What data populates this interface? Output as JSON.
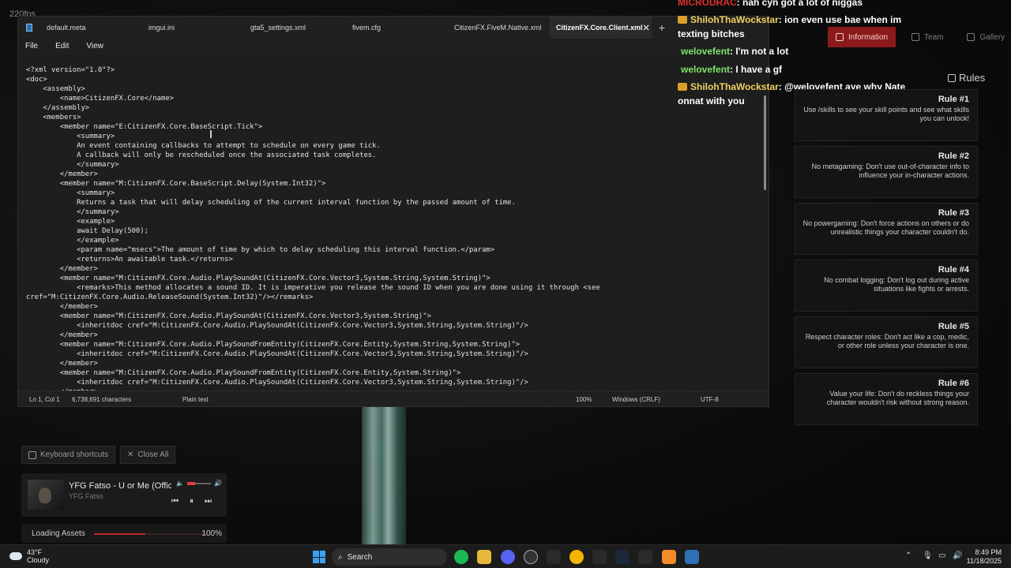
{
  "overlay": {
    "fps_text": "220fps"
  },
  "notepad": {
    "tabs": [
      {
        "label": "default.meta"
      },
      {
        "label": "imgui.ini"
      },
      {
        "label": "gta5_settings.xml"
      },
      {
        "label": "fivem.cfg"
      },
      {
        "label": "CitizenFX.FiveM.Native.xml"
      },
      {
        "label": "CitizenFX.Core.Client.xml",
        "active": true
      }
    ],
    "close_glyph": "✕",
    "newtab_glyph": "+",
    "menu": {
      "file": "File",
      "edit": "Edit",
      "view": "View"
    },
    "lines": [
      "<?xml version=\"1.0\"?>",
      "<doc>",
      "    <assembly>",
      "        <name>CitizenFX.Core</name>",
      "    </assembly>",
      "    <members>",
      "        <member name=\"E:CitizenFX.Core.BaseScript.Tick\">",
      "            <summary>",
      "            An event containing callbacks to attempt to schedule on every game tick.",
      "            A callback will only be rescheduled once the associated task completes.",
      "            </summary>",
      "        </member>",
      "        <member name=\"M:CitizenFX.Core.BaseScript.Delay(System.Int32)\">",
      "            <summary>",
      "            Returns a task that will delay scheduling of the current interval function by the passed amount of time.",
      "            </summary>",
      "            <example>",
      "            await Delay(500);",
      "            </example>",
      "            <param name=\"msecs\">The amount of time by which to delay scheduling this interval function.</param>",
      "            <returns>An awaitable task.</returns>",
      "        </member>",
      "        <member name=\"M:CitizenFX.Core.Audio.PlaySoundAt(CitizenFX.Core.Vector3,System.String,System.String)\">",
      "            <remarks>This method allocates a sound ID. It is imperative you release the sound ID when you are done using it through <see",
      "cref=\"M:CitizenFX.Core.Audio.ReleaseSound(System.Int32)\"/></remarks>",
      "        </member>",
      "        <member name=\"M:CitizenFX.Core.Audio.PlaySoundAt(CitizenFX.Core.Vector3,System.String)\">",
      "            <inheritdoc cref=\"M:CitizenFX.Core.Audio.PlaySoundAt(CitizenFX.Core.Vector3,System.String,System.String)\"/>",
      "        </member>",
      "        <member name=\"M:CitizenFX.Core.Audio.PlaySoundFromEntity(CitizenFX.Core.Entity,System.String,System.String)\">",
      "            <inheritdoc cref=\"M:CitizenFX.Core.Audio.PlaySoundAt(CitizenFX.Core.Vector3,System.String,System.String)\"/>",
      "        </member>",
      "        <member name=\"M:CitizenFX.Core.Audio.PlaySoundFromEntity(CitizenFX.Core.Entity,System.String)\">",
      "            <inheritdoc cref=\"M:CitizenFX.Core.Audio.PlaySoundAt(CitizenFX.Core.Vector3,System.String,System.String)\"/>",
      "        </member>"
    ],
    "status": {
      "position": "Ln 1, Col 1",
      "chars": "6,738,691 characters",
      "format": "Plain text",
      "zoom": "100%",
      "eol": "Windows (CRLF)",
      "encoding": "UTF-8"
    }
  },
  "chat": {
    "line0": {
      "name": "MICRODRAC",
      "msg": ": nah cyn got a lot of niggas"
    },
    "line1": {
      "name": "ShilohThaWockstar",
      "msg": ": ion even use bae when im texting bitches"
    },
    "line2": {
      "name": "welovefent",
      "msg": ": I'm not a lot"
    },
    "line3": {
      "name": "welovefent",
      "msg": ": I have a gf"
    },
    "line4": {
      "name": "ShilohThaWockstar",
      "msg": ": @welovefent aye why Nate onnat with you"
    }
  },
  "panel": {
    "tabs": {
      "information": "Information",
      "team": "Team",
      "gallery": "Gallery"
    },
    "rules_title": "Rules",
    "rules": [
      {
        "head": "Rule #1",
        "text": "Use /skills to see your skill points and see what skills you can unlock!"
      },
      {
        "head": "Rule #2",
        "text": "No metagaming: Don't use out-of-character info to influence your in-character actions."
      },
      {
        "head": "Rule #3",
        "text": "No powergaming: Don't force actions on others or do unrealistic things your character couldn't do."
      },
      {
        "head": "Rule #4",
        "text": "No combat logging: Don't log out during active situations like fights or arrests."
      },
      {
        "head": "Rule #5",
        "text": "Respect character roles: Don't act like a cop, medic, or other role unless your character is one."
      },
      {
        "head": "Rule #6",
        "text": "Value your life: Don't do reckless things your character wouldn't risk without strong reason."
      }
    ]
  },
  "overlay_buttons": {
    "shortcuts": "Keyboard shortcuts",
    "close_all": "Close All"
  },
  "media": {
    "title": "YFG Fatso - U or Me (Official",
    "artist": "YFG Fatso"
  },
  "loading": {
    "label": "Loading Assets",
    "percent_text": "100%",
    "progress": 0.46
  },
  "taskbar": {
    "weather_temp": "43°F",
    "weather_desc": "Cloudy",
    "search_label": "Search",
    "time": "8:49 PM",
    "date": "11/18/2025"
  }
}
